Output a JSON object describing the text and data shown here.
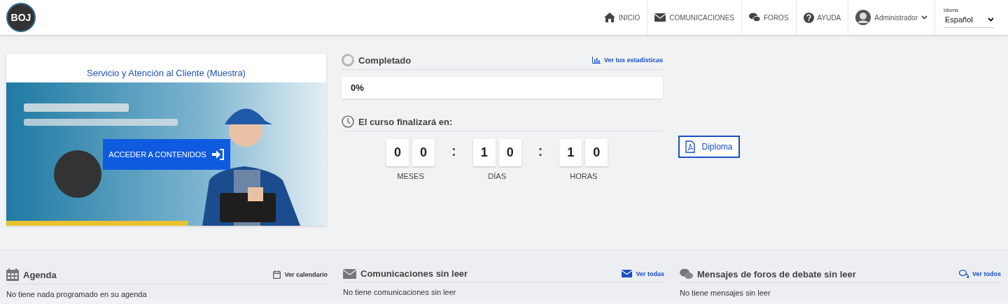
{
  "header": {
    "logo": "BOJ",
    "nav": [
      {
        "kind": "home",
        "label": "INICIO"
      },
      {
        "kind": "mail",
        "label": "COMUNICACIONES"
      },
      {
        "kind": "chat",
        "label": "FOROS"
      },
      {
        "kind": "help",
        "label": "AYUDA"
      },
      {
        "kind": "user",
        "label": "Administrador"
      }
    ],
    "language": {
      "label": "Idioma",
      "value": "Español"
    }
  },
  "course": {
    "title": "Servicio y Atención al Cliente (Muestra)",
    "button": "ACCEDER A CONTENIDOS"
  },
  "progress": {
    "title": "Completado",
    "link": "Ver tus estadísticas",
    "value": "0%"
  },
  "countdown": {
    "title": "El curso finalizará en:",
    "separator": ":",
    "units": [
      {
        "label": "MESES",
        "digits": [
          "0",
          "0"
        ]
      },
      {
        "label": "DÍAS",
        "digits": [
          "1",
          "0"
        ]
      },
      {
        "label": "HORAS",
        "digits": [
          "1",
          "0"
        ]
      }
    ]
  },
  "diploma": "Diploma",
  "panels": [
    {
      "kind": "agenda",
      "title": "Agenda",
      "link": "Ver calendario",
      "text": "No tiene nada programado en su agenda"
    },
    {
      "kind": "mail",
      "title": "Comunicaciones sin leer",
      "link": "Ver todas",
      "text": "No tiene comunicaciones sin leer"
    },
    {
      "kind": "forum",
      "title": "Mensajes de foros de debate sin leer",
      "link": "Ver todos",
      "text": "No tiene mensajes sin leer"
    }
  ]
}
